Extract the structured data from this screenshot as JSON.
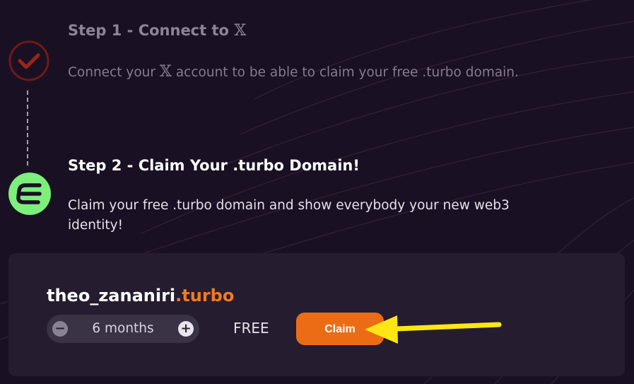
{
  "steps": [
    {
      "title": "Step 1 - Connect to",
      "title_glyph": "𝕏",
      "desc_before": "Connect your",
      "desc_glyph": "𝕏",
      "desc_after": "account to be able to claim your free .turbo domain.",
      "status_icon": "check-circle-icon"
    },
    {
      "title": "Step 2 - Claim Your .turbo Domain!",
      "description": "Claim your free .turbo domain and show everybody your new web3 identity!",
      "status_icon": "turbo-logo-icon"
    }
  ],
  "claim": {
    "domain_name": "theo_zananiri",
    "domain_tld": ".turbo",
    "duration": "6 months",
    "minus_label": "−",
    "plus_label": "+",
    "price": "FREE",
    "button_label": "Claim"
  },
  "colors": {
    "background": "#1a1023",
    "card": "#251c30",
    "accent_orange": "#ec6c16",
    "turbo_green": "#7cf07a",
    "check_red": "#9c2418",
    "arrow_yellow": "#ffe614"
  }
}
